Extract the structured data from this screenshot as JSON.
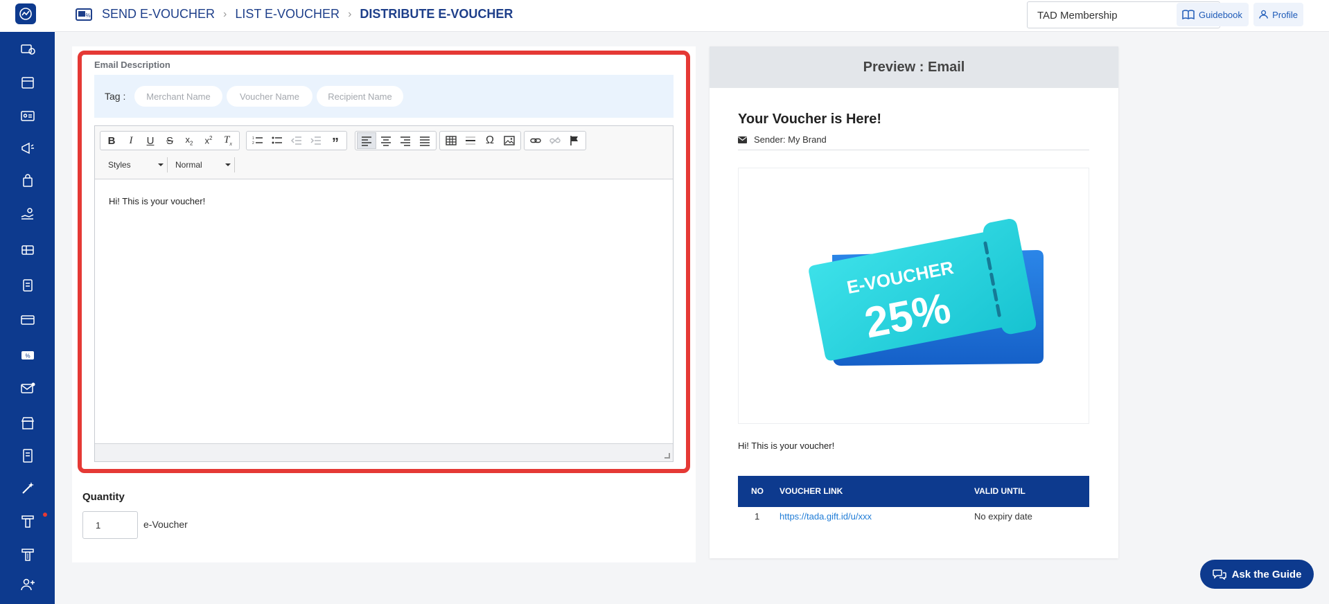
{
  "breadcrumb": {
    "items": [
      "SEND E-VOUCHER",
      "LIST E-VOUCHER",
      "DISTRIBUTE E-VOUCHER"
    ]
  },
  "header": {
    "program_select": "TAD Membership",
    "guidebook_label": "Guidebook",
    "profile_label": "Profile"
  },
  "editor_section": {
    "label": "Email Description",
    "tag_label": "Tag :",
    "tags": [
      "Merchant Name",
      "Voucher Name",
      "Recipient Name"
    ],
    "toolbar": {
      "styles_label": "Styles",
      "format_label": "Normal"
    },
    "content": "Hi! This is your voucher!"
  },
  "quantity": {
    "label": "Quantity",
    "value": "1",
    "unit": "e-Voucher"
  },
  "preview": {
    "heading": "Preview : Email",
    "title": "Your Voucher is Here!",
    "sender": "Sender: My Brand",
    "voucher_image": {
      "label": "E-VOUCHER",
      "discount": "25%"
    },
    "message": "Hi! This is your voucher!",
    "table": {
      "headers": [
        "NO",
        "VOUCHER LINK",
        "VALID UNTIL"
      ],
      "rows": [
        {
          "no": "1",
          "link": "https://tada.gift.id/u/xxx",
          "valid": "No expiry date"
        }
      ]
    }
  },
  "ask_guide_label": "Ask the Guide",
  "colors": {
    "primary": "#0d3a8e",
    "highlight_frame": "#e53935",
    "link": "#1e7bd6"
  }
}
